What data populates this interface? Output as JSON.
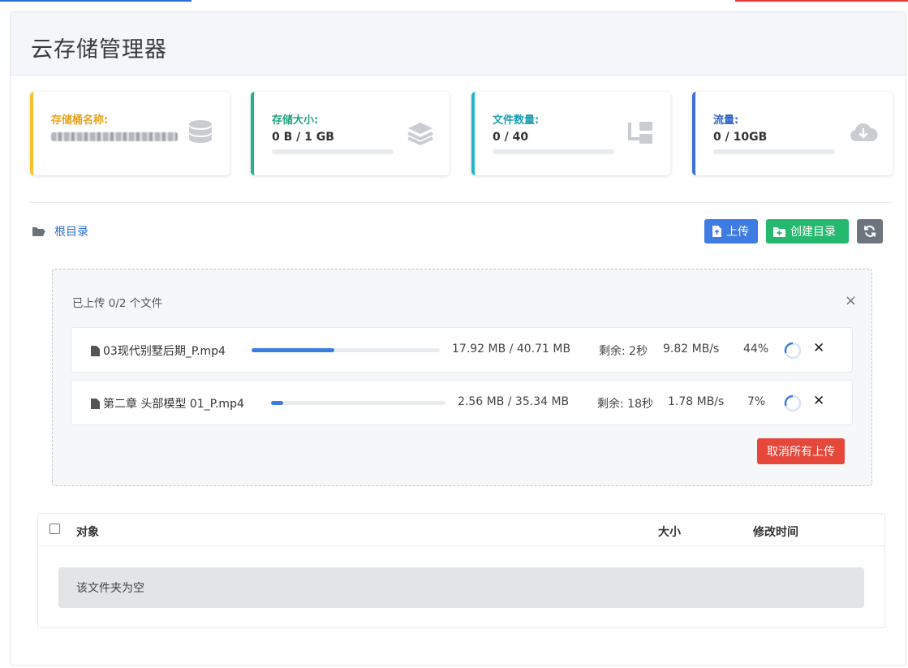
{
  "app": {
    "title": "云存储管理器"
  },
  "cards": [
    {
      "label": "存储桶名称:",
      "value": "",
      "icon": "database-icon",
      "color": "#f4c32a"
    },
    {
      "label": "存储大小:",
      "value": "0 B / 1 GB",
      "progress": 0,
      "icon": "layers-icon",
      "color": "#20b38a"
    },
    {
      "label": "文件数量:",
      "value": "0 / 40",
      "progress": 0,
      "icon": "tree-icon",
      "color": "#22b4c8"
    },
    {
      "label": "流量:",
      "value": "0 / 10GB",
      "progress": 0,
      "icon": "cloud-download-icon",
      "color": "#3b6fd6"
    }
  ],
  "breadcrumb": {
    "label": "根目录",
    "icon": "folder-open-icon"
  },
  "toolbar": {
    "upload_label": "上传",
    "mkdir_label": "创建目录"
  },
  "upload_panel": {
    "title": "已上传 0/2 个文件",
    "cancel_all_label": "取消所有上传",
    "files": [
      {
        "name": "03现代别墅后期_P.mp4",
        "size": "17.92 MB / 40.71 MB",
        "remaining": "剩余: 2秒",
        "speed": "9.82 MB/s",
        "percent": "44%",
        "progress": 44
      },
      {
        "name": "第二章 头部模型 01_P.mp4",
        "size": "2.56 MB / 35.34 MB",
        "remaining": "剩余: 18秒",
        "speed": "1.78 MB/s",
        "percent": "7%",
        "progress": 7
      }
    ]
  },
  "table": {
    "columns": [
      "对象",
      "大小",
      "修改时间"
    ],
    "empty_text": "该文件夹为空"
  },
  "colors": {
    "accent": "#3e7be3",
    "success": "#24b96f",
    "danger": "#e5483b"
  }
}
